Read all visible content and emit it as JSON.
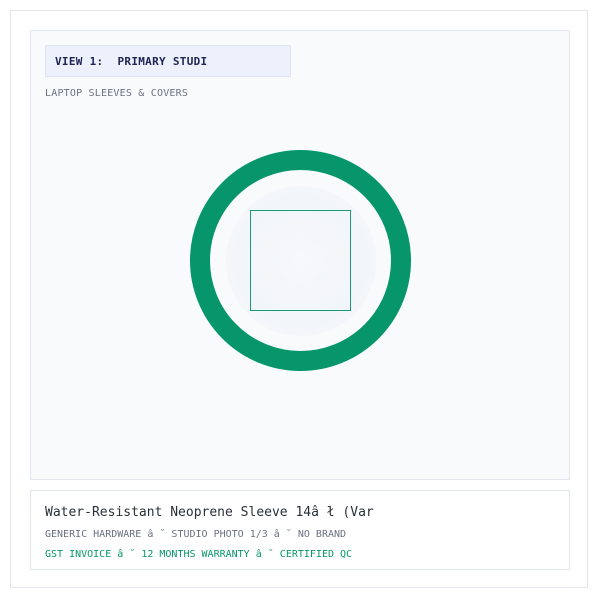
{
  "view": {
    "tag_number": "VIEW 1:",
    "tag_label": "PRIMARY STUDI",
    "category": "LAPTOP SLEEVES & COVERS"
  },
  "product": {
    "title": "Water-Resistant Neoprene Sleeve 14â ł (Var",
    "meta": "GENERIC HARDWARE â ˘ STUDIO PHOTO 1/3 â ˘ NO BRAND",
    "badges": "GST INVOICE â ˘ 12 MONTHS WARRANTY â ˘ CERTIFIED QC"
  },
  "colors": {
    "accent": "#07966b",
    "tag_text": "#1f2452",
    "panel_bg": "#f8fafc"
  },
  "icons": {
    "product_placeholder": "ring-with-square-placeholder"
  }
}
